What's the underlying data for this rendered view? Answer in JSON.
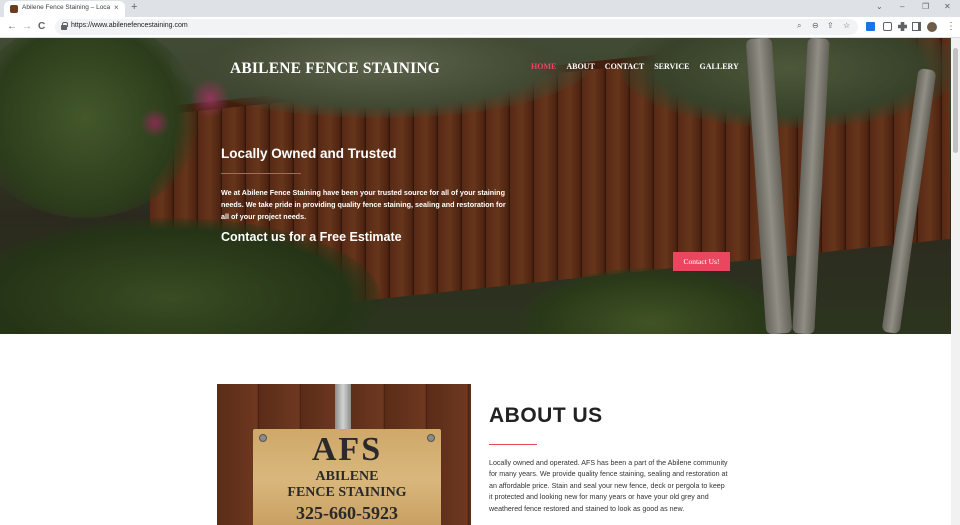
{
  "browser": {
    "tab_title": "Abilene Fence Staining – Locally Owned and Trusted",
    "tab_close": "×",
    "new_tab": "+",
    "url": "https://www.abilenefencestaining.com",
    "window_controls": {
      "minimize": "–",
      "restore": "❐",
      "close": "✕",
      "dropdown": "⌄"
    },
    "nav_icons": {
      "back": "←",
      "forward": "→",
      "reload": "C",
      "menu": "⋮"
    },
    "omnibox_icons": {
      "search": "⌕",
      "zoom": "⊖",
      "share": "⇪",
      "bookmark": "☆"
    },
    "accent": "#1a73e8"
  },
  "site": {
    "title": "ABILENE FENCE STAINING",
    "nav": [
      {
        "label": "HOME",
        "active": true
      },
      {
        "label": "ABOUT",
        "active": false
      },
      {
        "label": "CONTACT",
        "active": false
      },
      {
        "label": "SERVICE",
        "active": false
      },
      {
        "label": "GALLERY",
        "active": false
      }
    ],
    "accent_color": "#e8475f"
  },
  "hero": {
    "heading": "Locally Owned and Trusted",
    "text": "We at Abilene Fence Staining have been your trusted source for all of your staining needs. We take pride in providing quality fence staining, sealing and restoration for all of your project needs.",
    "cta_text": "Contact us for a Free Estimate",
    "button_label": "Contact Us!"
  },
  "about": {
    "heading": "ABOUT US",
    "text": "Locally owned and operated. AFS has been a part of the Abilene community for many years. We provide quality fence staining, sealing and restoration at an affordable price. Stain and seal your new fence, deck or pergola to keep it protected and looking new for many years or have your old grey and weathered fence restored and stained to look as good as new.",
    "sign": {
      "logo": "AFS",
      "line1": "ABILENE",
      "line2": "FENCE STAINING",
      "phone": "325-660-5923"
    }
  }
}
